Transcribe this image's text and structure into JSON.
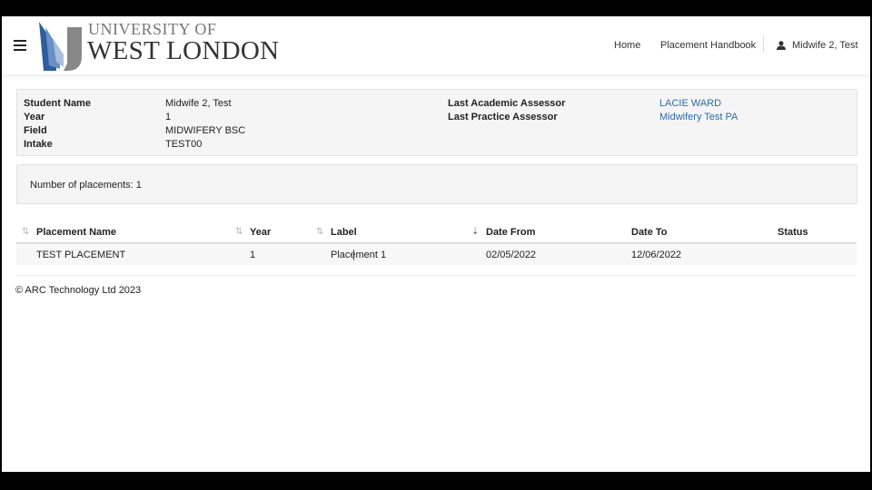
{
  "header": {
    "logo_line1": "UNIVERSITY OF",
    "logo_line2": "WEST LONDON",
    "nav_home": "Home",
    "nav_handbook": "Placement Handbook",
    "user_name": "Midwife 2, Test"
  },
  "student": {
    "labels": {
      "name": "Student Name",
      "year": "Year",
      "field": "Field",
      "intake": "Intake",
      "academic": "Last Academic Assessor",
      "practice": "Last Practice Assessor"
    },
    "name": "Midwife 2, Test",
    "year": "1",
    "field": "MIDWIFERY BSC",
    "intake": "TEST00",
    "academic_assessor": "LACIE WARD",
    "practice_assessor": "Midwifery Test PA"
  },
  "placement_count_text": "Number of placements: 1",
  "table": {
    "columns": [
      "Placement Name",
      "Year",
      "Label",
      "Date From",
      "Date To",
      "Status"
    ],
    "rows": [
      {
        "name": "TEST PLACEMENT",
        "year": "1",
        "label": "Placement 1",
        "date_from": "02/05/2022",
        "date_to": "12/06/2022",
        "status": ""
      }
    ]
  },
  "footer": {
    "copyright": "© ARC Technology Ltd 2023"
  },
  "colors": {
    "link": "#2c6aa8",
    "logo_blue": "#2f5d9e",
    "panel_bg": "#f5f5f5"
  },
  "icons": {
    "menu": "hamburger-icon",
    "user": "user-icon",
    "sort": "sort-icon"
  }
}
